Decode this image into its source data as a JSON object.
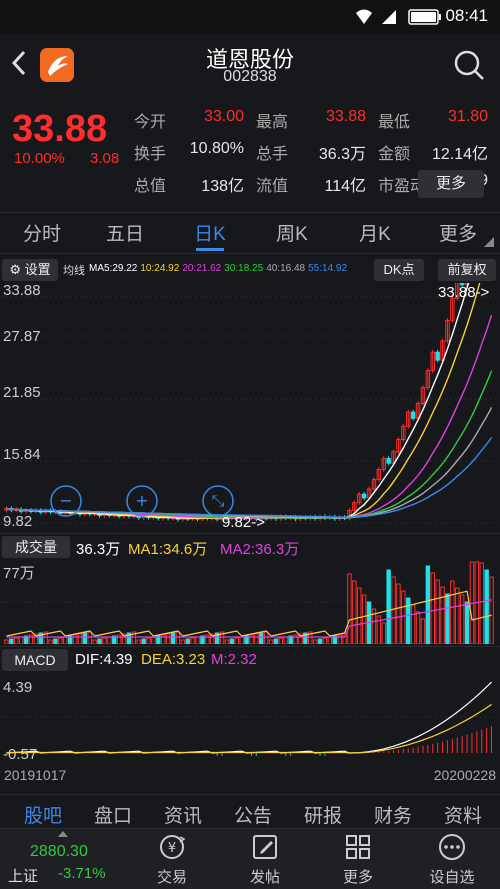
{
  "status_bar": {
    "time": "08:41"
  },
  "header": {
    "title": "道恩股份",
    "code": "002838"
  },
  "quote": {
    "price": "33.88",
    "change_pct": "10.00%",
    "change": "3.08",
    "stats": [
      {
        "label": "今开",
        "value": "33.00",
        "red": true
      },
      {
        "label": "最高",
        "value": "33.88",
        "red": true
      },
      {
        "label": "最低",
        "value": "31.80",
        "red": true
      },
      {
        "label": "换手",
        "value": "10.80%",
        "red": false
      },
      {
        "label": "总手",
        "value": "36.3万",
        "red": false
      },
      {
        "label": "金额",
        "value": "12.14亿",
        "red": false
      },
      {
        "label": "总值",
        "value": "138亿",
        "red": false
      },
      {
        "label": "流值",
        "value": "114亿",
        "red": false
      },
      {
        "label": "市盈动",
        "value": "81.49",
        "red": false
      }
    ],
    "more_label": "更多"
  },
  "period_tabs": [
    "分时",
    "五日",
    "日K",
    "周K",
    "月K",
    "更多"
  ],
  "active_period": "日K",
  "ma_bar": {
    "settings_label": "设置",
    "ma_label": "均线",
    "items": [
      {
        "text": "MA5:29.22",
        "color": "#ffffff"
      },
      {
        "text": "10:24.92",
        "color": "#f5d33a"
      },
      {
        "text": "20:21.62",
        "color": "#e040e0"
      },
      {
        "text": "30:18.25",
        "color": "#2ecc40"
      },
      {
        "text": "40:16.48",
        "color": "#aaaaaa"
      },
      {
        "text": "55:14.92",
        "color": "#3b88e8"
      }
    ],
    "dk_label": "DK点",
    "fq_label": "前复权"
  },
  "kline": {
    "y_labels": [
      "33.88",
      "27.87",
      "21.85",
      "15.84",
      "9.82"
    ],
    "last_price_tag": "33.88->",
    "low_tag": "9.82->"
  },
  "volume": {
    "label": "成交量",
    "vol": "36.3万",
    "ma1": "MA1:34.6万",
    "ma2": "MA2:36.3万",
    "max_label": "77万"
  },
  "macd": {
    "label": "MACD",
    "dif": "DIF:4.39",
    "dea": "DEA:3.23",
    "m": "M:2.32",
    "top": "4.39",
    "bottom": "-0.57"
  },
  "dates": {
    "start": "20191017",
    "end": "20200228"
  },
  "bottom_tabs": [
    "股吧",
    "盘口",
    "资讯",
    "公告",
    "研报",
    "财务",
    "资料"
  ],
  "index_info": {
    "value": "2880.30",
    "name": "上证",
    "pct": "-3.71%"
  },
  "nav": [
    {
      "label": "交易",
      "icon": "trade-icon"
    },
    {
      "label": "发帖",
      "icon": "edit-icon"
    },
    {
      "label": "更多",
      "icon": "grid-icon"
    },
    {
      "label": "设自选",
      "icon": "dots-icon"
    }
  ],
  "colors": {
    "up": "#ff2d2d",
    "down": "#1ee0e8",
    "accent": "#3b88e8"
  }
}
